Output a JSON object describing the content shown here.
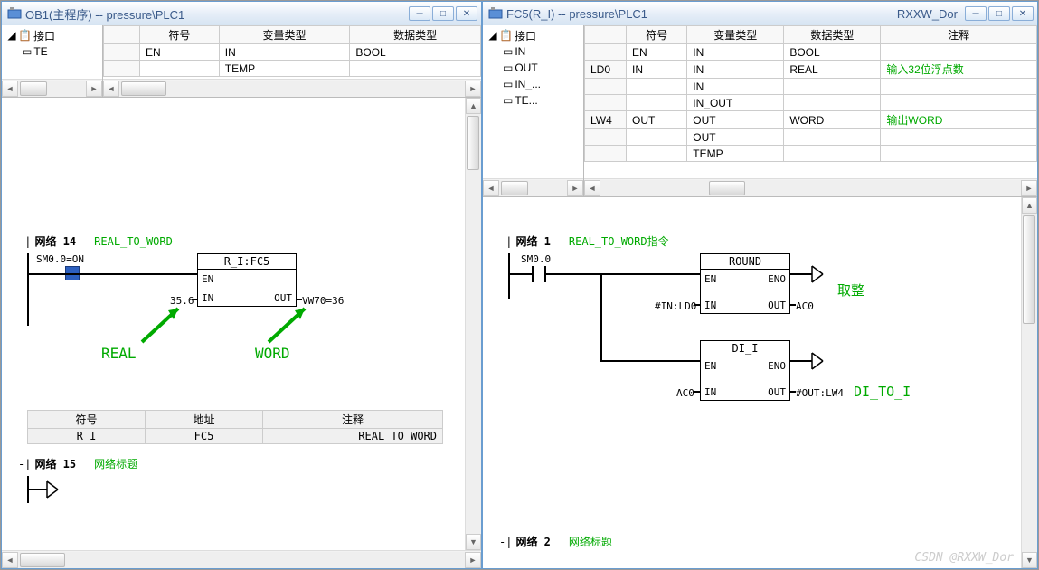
{
  "left": {
    "title": "OB1(主程序) -- pressure\\PLC1",
    "tree": {
      "root": "接口",
      "items": [
        "TE"
      ]
    },
    "table_head": [
      "",
      "符号",
      "变量类型",
      "数据类型"
    ],
    "rows": [
      {
        "c1": "",
        "c2": "EN",
        "c3": "IN",
        "c4": "BOOL"
      },
      {
        "c1": "",
        "c2": "",
        "c3": "TEMP",
        "c4": ""
      }
    ],
    "net14": {
      "label": "网络 14",
      "comment": "REAL_TO_WORD"
    },
    "sm": "SM0.0=ON",
    "box": {
      "title": "R_I:FC5",
      "p_en": "EN",
      "p_in": "IN",
      "p_out": "OUT",
      "in_val": "35.6",
      "out_val": "VW70=36"
    },
    "anno": {
      "real": "REAL",
      "word": "WORD"
    },
    "sym_head": {
      "c1": "符号",
      "c2": "地址",
      "c3": "注释"
    },
    "sym_row": {
      "c1": "R_I",
      "c2": "FC5",
      "c3": "REAL_TO_WORD"
    },
    "net15": {
      "label": "网络 15",
      "comment": "网络标题"
    }
  },
  "right": {
    "title": "FC5(R_I) -- pressure\\PLC1",
    "title_extra": "RXXW_Dor",
    "tree": {
      "root": "接口",
      "items": [
        "IN",
        "OUT",
        "IN_...",
        "TE..."
      ]
    },
    "table_head": [
      "",
      "符号",
      "变量类型",
      "数据类型",
      "注释"
    ],
    "rows": [
      {
        "c1": "",
        "c2": "EN",
        "c3": "IN",
        "c4": "BOOL",
        "c5": ""
      },
      {
        "c1": "LD0",
        "c2": "IN",
        "c3": "IN",
        "c4": "REAL",
        "c5": "输入32位浮点数"
      },
      {
        "c1": "",
        "c2": "",
        "c3": "IN",
        "c4": "",
        "c5": ""
      },
      {
        "c1": "",
        "c2": "",
        "c3": "IN_OUT",
        "c4": "",
        "c5": ""
      },
      {
        "c1": "LW4",
        "c2": "OUT",
        "c3": "OUT",
        "c4": "WORD",
        "c5": "输出WORD"
      },
      {
        "c1": "",
        "c2": "",
        "c3": "OUT",
        "c4": "",
        "c5": ""
      },
      {
        "c1": "",
        "c2": "",
        "c3": "TEMP",
        "c4": "",
        "c5": ""
      }
    ],
    "net1": {
      "label": "网络 1",
      "comment": "REAL_TO_WORD指令"
    },
    "sm": "SM0.0",
    "box1": {
      "title": "ROUND",
      "p_en": "EN",
      "p_eno": "ENO",
      "p_in": "IN",
      "p_out": "OUT",
      "in_val": "#IN:LD0",
      "out_val": "AC0"
    },
    "anno1": "取整",
    "box2": {
      "title": "DI_I",
      "p_en": "EN",
      "p_eno": "ENO",
      "p_in": "IN",
      "p_out": "OUT",
      "in_val": "AC0",
      "out_val": "#OUT:LW4"
    },
    "anno2": "DI_TO_I",
    "net2": {
      "label": "网络 2",
      "comment": "网络标题"
    }
  },
  "wm": "CSDN @RXXW_Dor"
}
